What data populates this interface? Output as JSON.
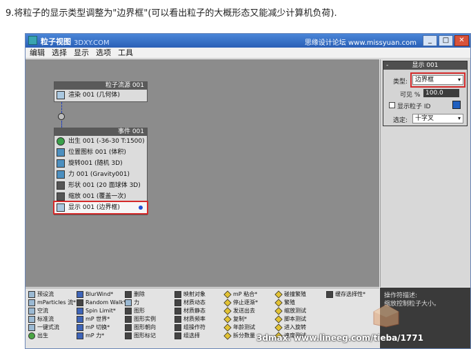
{
  "caption": "9.将粒子的显示类型调整为\"边界框\"(可以看出粒子的大概形态又能减少计算机负荷).",
  "window": {
    "title": "粒子视图",
    "watermark": "3DXY.COM",
    "site": "思缘设计论坛 www.missyuan.com",
    "buttons": [
      "_",
      "□",
      "✕"
    ]
  },
  "menu": [
    "编辑",
    "选择",
    "显示",
    "选项",
    "工具"
  ],
  "source_node": {
    "header": "粒子流源 001",
    "rows": [
      {
        "label": "渲染 001 (几何体)",
        "icon": "render-icon"
      }
    ]
  },
  "event_node": {
    "header": "事件 001",
    "rows": [
      {
        "label": "出生 001 (-36-30 T:1500)",
        "icon": "birth-icon"
      },
      {
        "label": "位置图标 001 (体积)",
        "icon": "position-icon"
      },
      {
        "label": "旋转001 (随机 3D)",
        "icon": "rotation-icon"
      },
      {
        "label": "力 001 (Gravity001)",
        "icon": "force-icon"
      },
      {
        "label": "形状 001 (20 面球体 3D)",
        "icon": "shape-icon"
      },
      {
        "label": "缩放 001 (覆盖一次)",
        "icon": "scale-icon"
      },
      {
        "label": "显示 001 (边界框)",
        "icon": "display-icon"
      }
    ]
  },
  "right_panel": {
    "title": "显示 001",
    "collapse": "-",
    "type_label": "类型:",
    "type_value": "边界框",
    "visible_label": "可见 %",
    "visible_value": "100.0",
    "show_id_label": "显示粒子 ID",
    "show_id_checked": false,
    "swatch_color": "#1f5fbf",
    "selected_label": "选定:",
    "selected_value": "十字叉"
  },
  "depot": {
    "col1": [
      "预设流",
      "mParticles 流*",
      "空流",
      "标准流",
      "一键式流",
      "出生"
    ],
    "col2": [
      "BlurWind*",
      "Random Walk*",
      "Spin Limit*",
      "mP 世界*",
      "mP 切换*",
      "mP 力*"
    ],
    "col3": [
      "删除",
      "力",
      "图形",
      "图形实例",
      "图形朝向",
      "图形标记"
    ],
    "col4": [
      "映射对象",
      "材质动态",
      "材质静态",
      "材质频率",
      "组操作符",
      "组选择"
    ],
    "col5": [
      "mP 粘合*",
      "停止逐渐*",
      "发送出去",
      "复制*",
      "年龄测试",
      "拆分数量"
    ],
    "col6": [
      "碰撞繁殖",
      "繁殖",
      "缩放测试",
      "脚本测试",
      "进入旋转",
      "速度测试"
    ],
    "col7": [
      "缓存选择性*"
    ]
  },
  "description": {
    "label": "操作符描述:",
    "text": "缩放控制粒子大小。"
  },
  "watermark_bottom": "3dmax. www.lineeg.com/tieba/1771",
  "colors": {
    "highlight": "#d42a2a",
    "canvas": "#8c8c8c",
    "titlebar": "#2a5fb6"
  }
}
